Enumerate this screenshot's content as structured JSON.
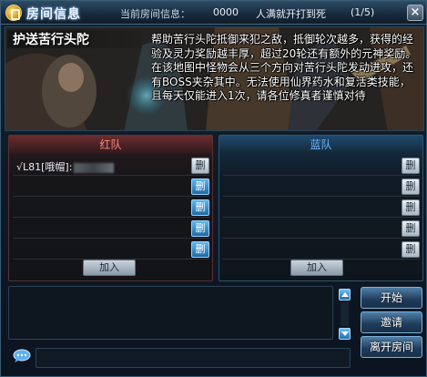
{
  "window": {
    "title": "房间信息",
    "room_label": "当前房间信息：",
    "room_number": "0000",
    "room_desc": "人满就开打到死",
    "room_count": "(1/5)",
    "close_label": "×"
  },
  "banner": {
    "mode_name": "护送苦行头陀",
    "description": "帮助苦行头陀抵御来犯之敌，抵御轮次越多，获得的经验及灵力奖励越丰厚，超过20轮还有额外的元神奖励。在该地图中怪物会从三个方向对苦行头陀发动进攻，还有BOSS夹杂其中。无法使用仙界药水和复活类技能，且每天仅能进入1次，请各位修真者谨慎对待"
  },
  "red_team": {
    "header": "红队",
    "slots": [
      {
        "text": "√L81[哦帽]:",
        "button": "删"
      },
      {
        "text": "",
        "button": "删"
      },
      {
        "text": "",
        "button": "删"
      },
      {
        "text": "",
        "button": "删"
      },
      {
        "text": "",
        "button": "删"
      }
    ],
    "join_label": "加入"
  },
  "blue_team": {
    "header": "蓝队",
    "slots": [
      {
        "text": "",
        "button": "删"
      },
      {
        "text": "",
        "button": "删"
      },
      {
        "text": "",
        "button": "删"
      },
      {
        "text": "",
        "button": "删"
      },
      {
        "text": "",
        "button": "删"
      }
    ],
    "join_label": "加入"
  },
  "chat": {
    "input_value": ""
  },
  "actions": {
    "start": "开始",
    "invite": "邀请",
    "leave": "离开房间"
  },
  "colors": {
    "red_team_accent": "#ff8a7a",
    "blue_team_accent": "#6fb6ff",
    "button_blue": "#1f6fad"
  },
  "icons": {
    "title": "room-info-icon",
    "close": "close-icon",
    "chat": "chat-bubble-icon",
    "scroll_up": "arrow-up-icon",
    "scroll_down": "arrow-down-icon"
  }
}
